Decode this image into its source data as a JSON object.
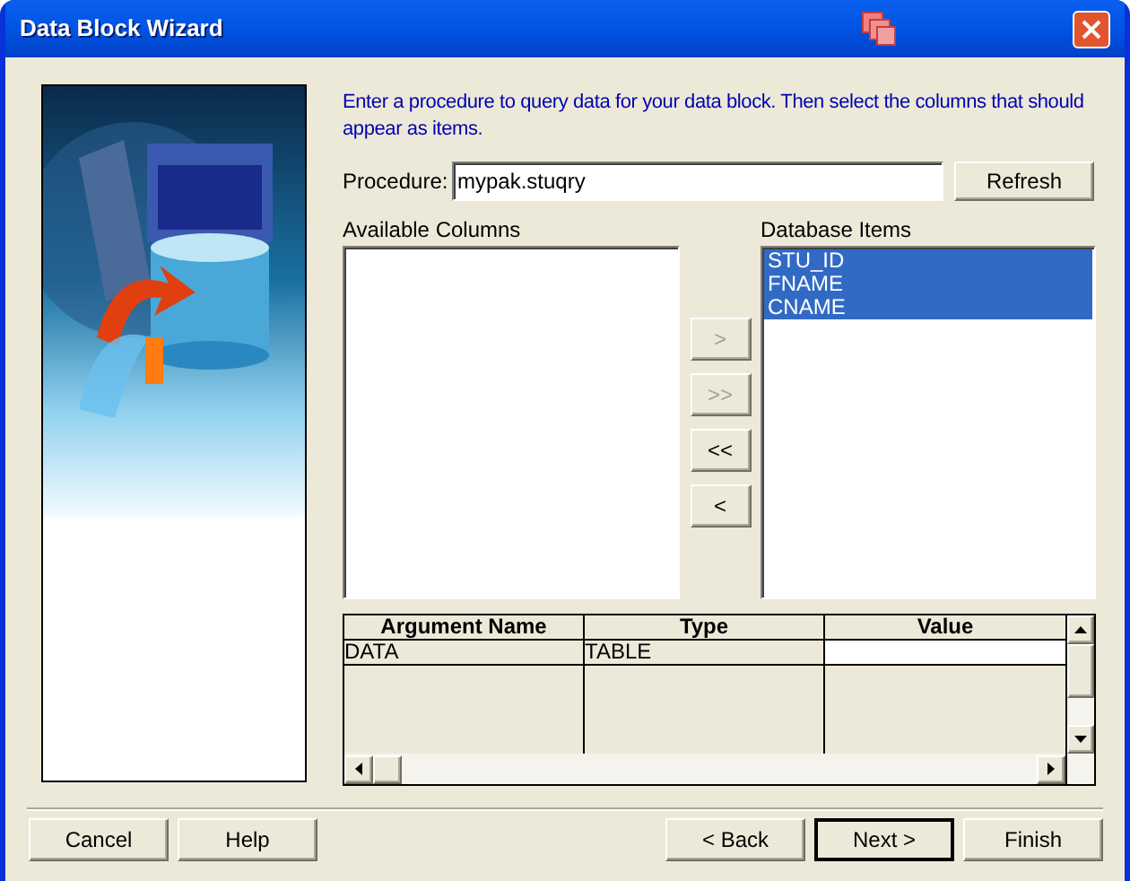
{
  "window": {
    "title": "Data Block Wizard"
  },
  "instructions": "Enter a procedure to query data for your data block. Then select the columns that should appear as items.",
  "procedure": {
    "label": "Procedure:",
    "value": "mypak.stuqry"
  },
  "refresh_button": "Refresh",
  "available_columns": {
    "label": "Available Columns"
  },
  "database_items": {
    "label": "Database Items",
    "items": [
      {
        "text": "STU_ID",
        "selected": true
      },
      {
        "text": "FNAME",
        "selected": true
      },
      {
        "text": "CNAME",
        "selected": true
      }
    ]
  },
  "move_buttons": [
    {
      "label": ">",
      "disabled": true
    },
    {
      "label": ">>",
      "disabled": true
    },
    {
      "label": "<<",
      "disabled": false
    },
    {
      "label": "<",
      "disabled": false
    }
  ],
  "arguments": {
    "columns": [
      "Argument Name",
      "Type",
      "Value"
    ],
    "rows": [
      {
        "argument_name": "DATA",
        "type": "TABLE"
      }
    ]
  },
  "left_buttons": [
    {
      "label": "Cancel",
      "default": false
    },
    {
      "label": "Help",
      "default": false
    }
  ],
  "right_buttons": [
    {
      "label": "< Back",
      "default": false
    },
    {
      "label": "Next >",
      "default": true
    },
    {
      "label": "Finish",
      "default": false
    }
  ]
}
